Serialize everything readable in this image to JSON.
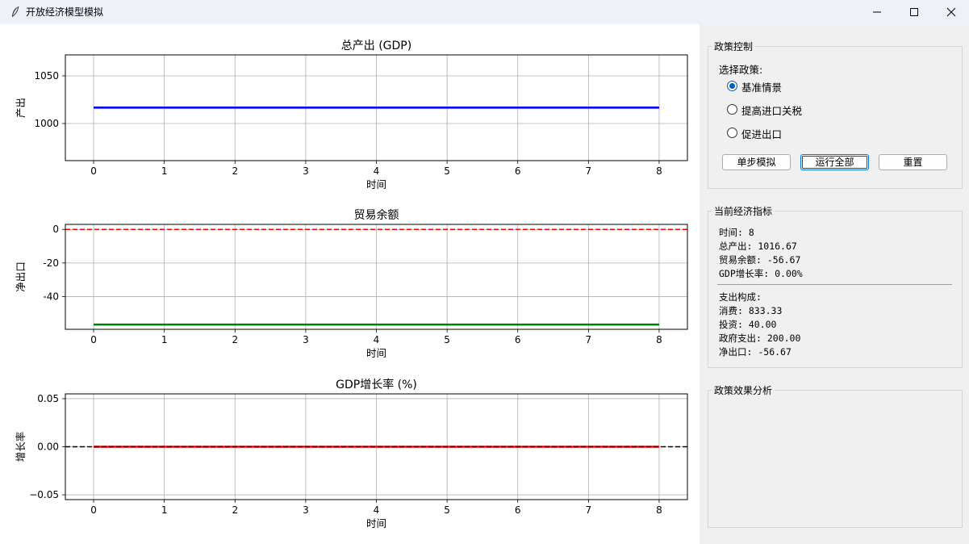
{
  "window": {
    "title": "开放经济模型模拟"
  },
  "policy_control": {
    "frame_title": "政策控制",
    "select_label": "选择政策:",
    "options": [
      "基准情景",
      "提高进口关税",
      "促进出口"
    ],
    "selected_index": 0,
    "buttons": {
      "step": "单步模拟",
      "run_all": "运行全部",
      "reset": "重置"
    }
  },
  "indicators": {
    "frame_title": "当前经济指标",
    "lines": [
      "时间: 8",
      "总产出: 1016.67",
      "贸易余额: -56.67",
      "GDP增长率: 0.00%"
    ],
    "spend_lines": [
      "支出构成:",
      "消费: 833.33",
      "投资: 40.00",
      "政府支出: 200.00",
      "净出口: -56.67"
    ]
  },
  "analysis": {
    "frame_title": "政策效果分析"
  },
  "chart_data": [
    {
      "type": "line",
      "title": "总产出 (GDP)",
      "xlabel": "时间",
      "ylabel": "产出",
      "x": [
        0,
        1,
        2,
        3,
        4,
        5,
        6,
        7,
        8
      ],
      "xlim": [
        -0.4,
        8.4
      ],
      "ylim": [
        961,
        1072
      ],
      "yticks": [
        1000,
        1050
      ],
      "grid": true,
      "series": [
        {
          "values": [
            1016.67,
            1016.67,
            1016.67,
            1016.67,
            1016.67,
            1016.67,
            1016.67,
            1016.67,
            1016.67
          ],
          "color": "#0000ff",
          "style": "solid"
        }
      ]
    },
    {
      "type": "line",
      "title": "贸易余额",
      "xlabel": "时间",
      "ylabel": "净出口",
      "x": [
        0,
        1,
        2,
        3,
        4,
        5,
        6,
        7,
        8
      ],
      "xlim": [
        -0.4,
        8.4
      ],
      "ylim": [
        -59.5,
        3
      ],
      "yticks": [
        0,
        -20,
        -40
      ],
      "grid": true,
      "hline": {
        "y": 0,
        "color": "#ff0000",
        "style": "dashed"
      },
      "series": [
        {
          "values": [
            -56.67,
            -56.67,
            -56.67,
            -56.67,
            -56.67,
            -56.67,
            -56.67,
            -56.67,
            -56.67
          ],
          "color": "#008000",
          "style": "solid"
        }
      ]
    },
    {
      "type": "line",
      "title": "GDP增长率 (%)",
      "xlabel": "时间",
      "ylabel": "增长率",
      "x": [
        0,
        1,
        2,
        3,
        4,
        5,
        6,
        7,
        8
      ],
      "xlim": [
        -0.4,
        8.4
      ],
      "ylim": [
        -0.055,
        0.055
      ],
      "yticks": [
        0.05,
        0.0,
        -0.05
      ],
      "ytick_labels": [
        "0.05",
        "0.00",
        "−0.05"
      ],
      "grid": true,
      "hline": {
        "y": 0,
        "color": "#000000",
        "style": "dashed"
      },
      "series": [
        {
          "values": [
            0,
            0,
            0,
            0,
            0,
            0,
            0,
            0,
            0
          ],
          "color": "#ff0000",
          "style": "solid"
        }
      ]
    }
  ]
}
